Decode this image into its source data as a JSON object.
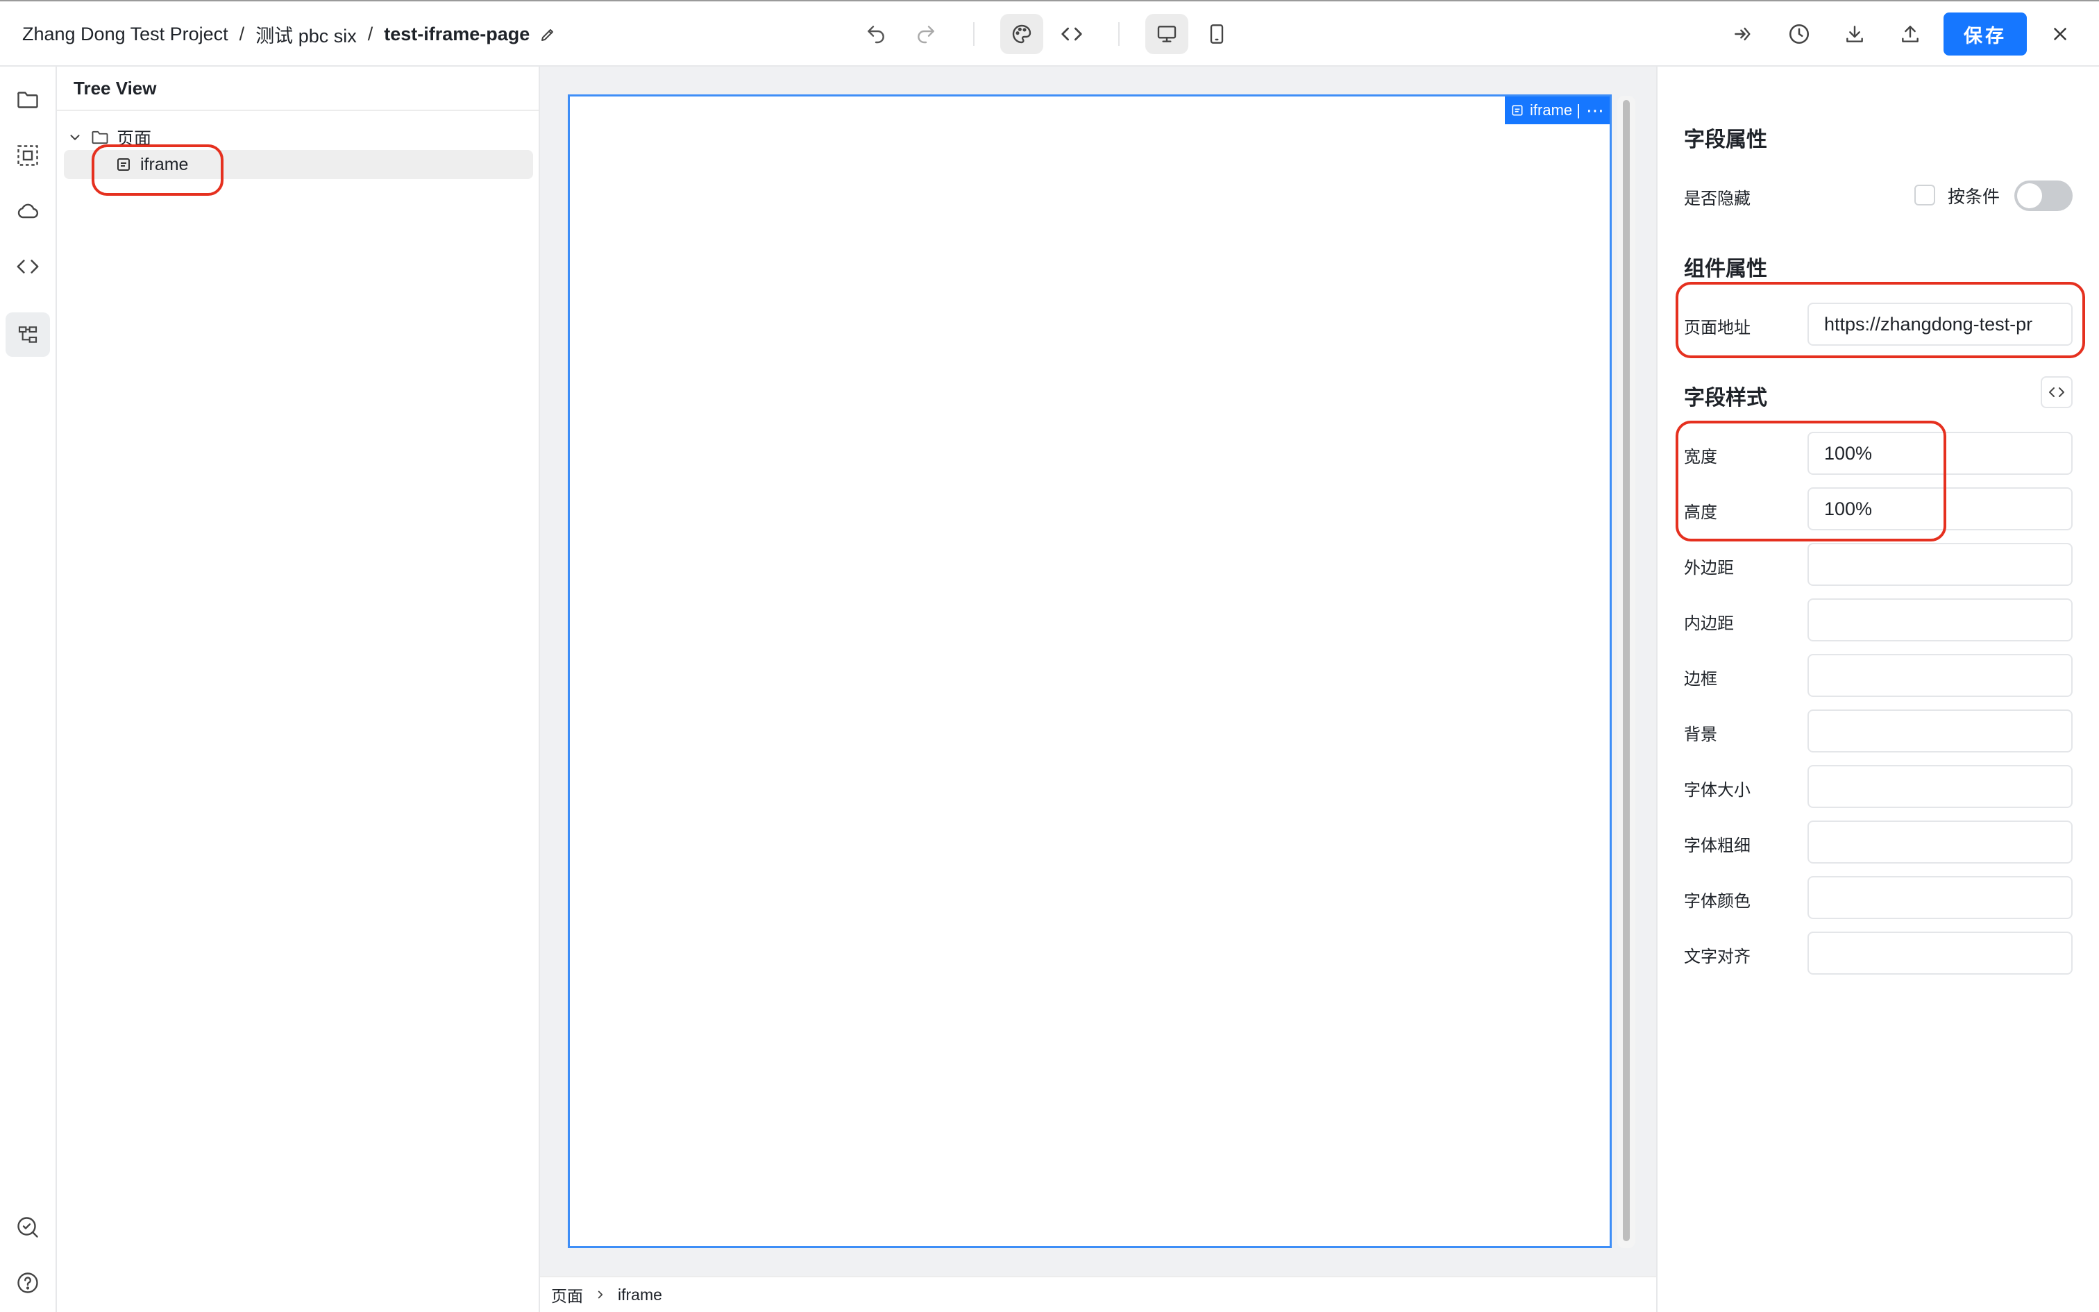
{
  "header": {
    "breadcrumb": {
      "project": "Zhang Dong Test Project",
      "separator": "/",
      "app": "测试 pbc six",
      "page": "test-iframe-page"
    },
    "save_label": "保存"
  },
  "tree": {
    "title": "Tree View",
    "root_label": "页面",
    "child_label": "iframe"
  },
  "canvas": {
    "frame_tag_label": "iframe |",
    "more_symbol": "⋯"
  },
  "bottom_breadcrumb": {
    "root": "页面",
    "current": "iframe"
  },
  "props": {
    "field_props_title": "字段属性",
    "hidden_label": "是否隐藏",
    "condition_label": "按条件",
    "condition_toggle_on": false,
    "component_props_title": "组件属性",
    "page_url_label": "页面地址",
    "page_url_value": "https://zhangdong-test-pr",
    "field_style_title": "字段样式",
    "style_fields": [
      {
        "label": "宽度",
        "value": "100%"
      },
      {
        "label": "高度",
        "value": "100%"
      },
      {
        "label": "外边距",
        "value": ""
      },
      {
        "label": "内边距",
        "value": ""
      },
      {
        "label": "边框",
        "value": ""
      },
      {
        "label": "背景",
        "value": ""
      },
      {
        "label": "字体大小",
        "value": ""
      },
      {
        "label": "字体粗细",
        "value": ""
      },
      {
        "label": "字体颜色",
        "value": ""
      },
      {
        "label": "文字对齐",
        "value": ""
      }
    ]
  },
  "colors": {
    "accent": "#1677ff",
    "selection_border": "#3e8ef7",
    "annotation_red": "#e5301f"
  }
}
